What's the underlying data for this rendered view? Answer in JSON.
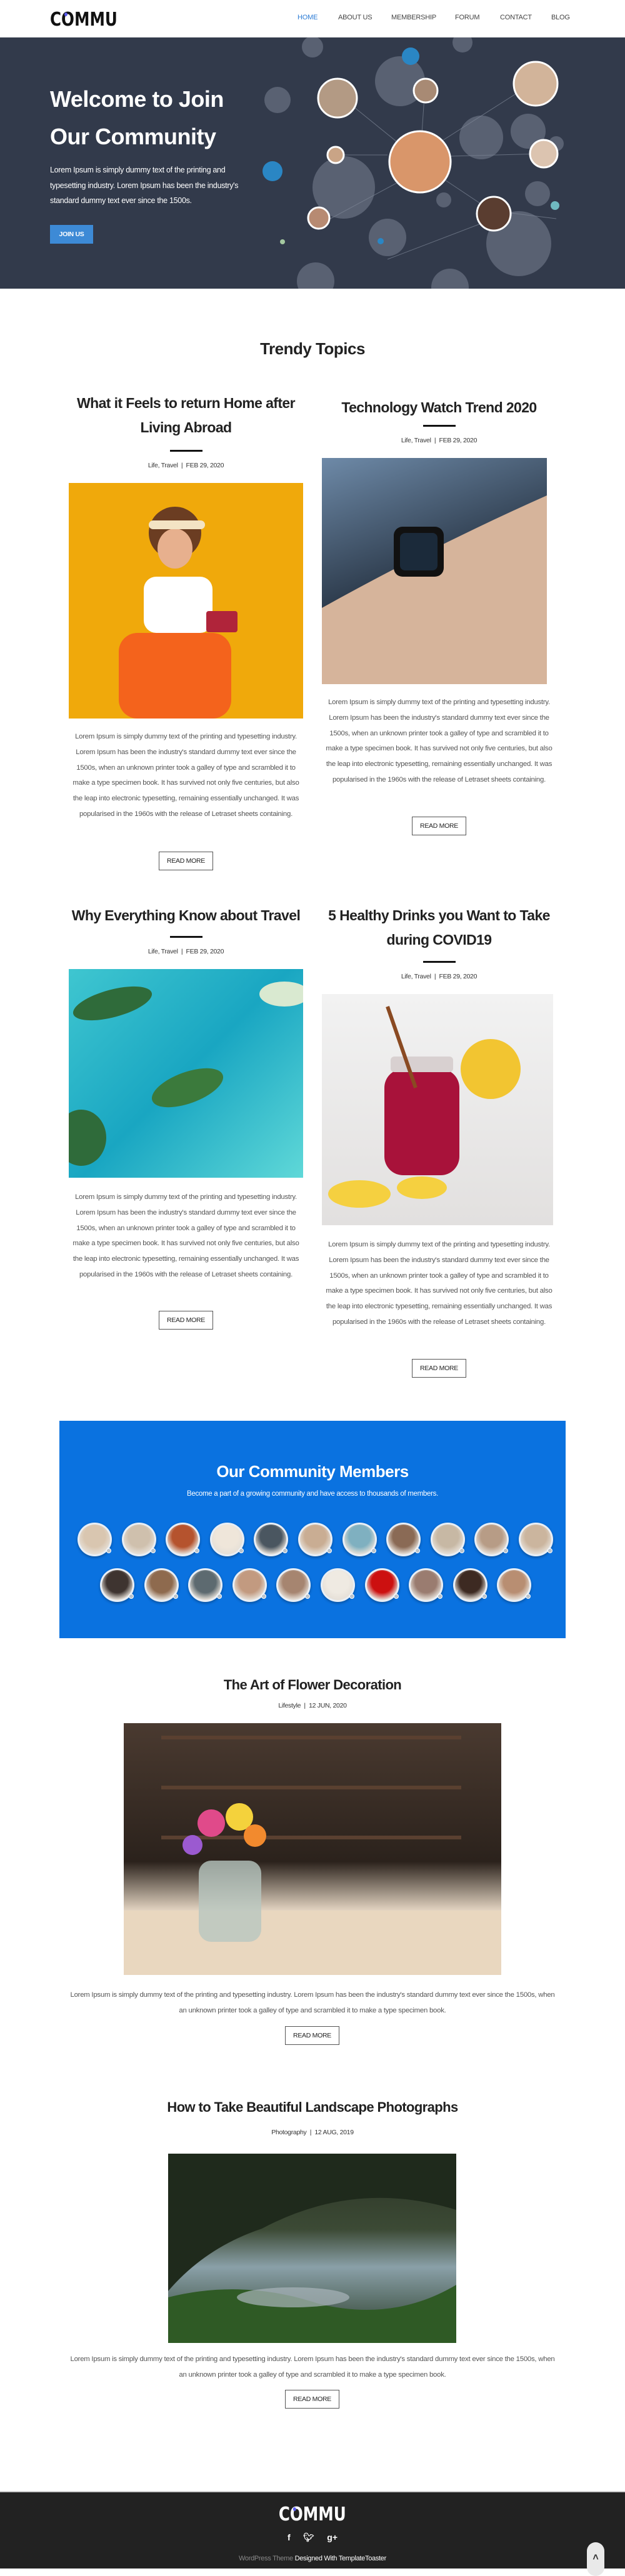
{
  "brand": {
    "logo": "COMMU",
    "accent": "#2e7dd6"
  },
  "nav": {
    "items": [
      {
        "label": "HOME",
        "active": true
      },
      {
        "label": "ABOUT US"
      },
      {
        "label": "MEMBERSHIP"
      },
      {
        "label": "FORUM"
      },
      {
        "label": "CONTACT"
      },
      {
        "label": "BLOG"
      }
    ]
  },
  "hero": {
    "title_line1": "Welcome to Join",
    "title_line2": "Our Community",
    "text": "Lorem Ipsum is simply dummy text of the printing and typesetting industry. Lorem Ipsum has been the industry's standard dummy text ever since the 1500s.",
    "button": "JOIN US"
  },
  "trendy": {
    "title": "Trendy Topics",
    "read_more": "READ MORE",
    "posts": [
      {
        "title": "What it Feels to return Home after Living Abroad",
        "categories": "Life, Travel",
        "date": "FEB 29, 2020",
        "image": "woman-with-orange-suitcase",
        "text": "Lorem Ipsum is simply dummy text of the printing and typesetting industry. Lorem Ipsum has been the industry's standard dummy text ever since the 1500s, when an unknown printer took a galley of type and scrambled it to make a type specimen book. It has survived not only five centuries, but also the leap into electronic typesetting, remaining essentially unchanged. It was popularised in the 1960s with the release of Letraset sheets containing."
      },
      {
        "title": "Technology Watch Trend 2020",
        "categories": "Life, Travel",
        "date": "FEB 29, 2020",
        "image": "smartwatch-on-steering-wheel",
        "text": "Lorem Ipsum is simply dummy text of the printing and typesetting industry. Lorem Ipsum has been the industry's standard dummy text ever since the 1500s, when an unknown printer took a galley of type and scrambled it to make a type specimen book. It has survived not only five centuries, but also the leap into electronic typesetting, remaining essentially unchanged. It was popularised in the 1960s with the release of Letraset sheets containing."
      },
      {
        "title": "Why Everything Know about Travel",
        "categories": "Life, Travel",
        "date": "FEB 29, 2020",
        "image": "aerial-island-sea",
        "text": "Lorem Ipsum is simply dummy text of the printing and typesetting industry. Lorem Ipsum has been the industry's standard dummy text ever since the 1500s, when an unknown printer took a galley of type and scrambled it to make a type specimen book. It has survived not only five centuries, but also the leap into electronic typesetting, remaining essentially unchanged. It was popularised in the 1960s with the release of Letraset sheets containing."
      },
      {
        "title": "5 Healthy Drinks you Want to Take during COVID19",
        "categories": "Life, Travel",
        "date": "FEB 29, 2020",
        "image": "berry-drink-jar-lemon",
        "text": "Lorem Ipsum is simply dummy text of the printing and typesetting industry. Lorem Ipsum has been the industry's standard dummy text ever since the 1500s, when an unknown printer took a galley of type and scrambled it to make a type specimen book. It has survived not only five centuries, but also the leap into electronic typesetting, remaining essentially unchanged. It was popularised in the 1960s with the release of Letraset sheets containing."
      }
    ]
  },
  "community": {
    "title": "Our Community Members",
    "subtitle": "Become a part of a growing community and have access to thousands of members.",
    "background": "#0a72e0",
    "member_colors": [
      "#d9c6b0",
      "#cfc0ad",
      "#b5532e",
      "#efe6da",
      "#4a5660",
      "#c9ad93",
      "#7fb0c0",
      "#8a6a55",
      "#c7b8a4",
      "#b79c86",
      "#cbb59e",
      "#3e3430",
      "#8e6a4e",
      "#5d6a70",
      "#c29a80",
      "#a68570",
      "#efeae2",
      "#cc1010",
      "#9a7c70",
      "#3d2a22",
      "#b88e72"
    ]
  },
  "articles": [
    {
      "title": "The Art of Flower Decoration",
      "category": "Lifestyle",
      "date": "12 JUN, 2020",
      "image": "flowers-in-glass-jar",
      "text": "Lorem Ipsum is simply dummy text of the printing and typesetting industry. Lorem Ipsum has been the industry's standard dummy text ever since the 1500s, when an unknown printer took a galley of type and scrambled it to make a type specimen book.",
      "button": "READ MORE"
    },
    {
      "title": "How to Take Beautiful Landscape Photographs",
      "category": "Photography",
      "date": "12 AUG, 2019",
      "image": "cave-landscape-water",
      "text": "Lorem Ipsum is simply dummy text of the printing and typesetting industry. Lorem Ipsum has been the industry's standard dummy text ever since the 1500s, when an unknown printer took a galley of type and scrambled it to make a type specimen book.",
      "button": "READ MORE"
    }
  ],
  "footer": {
    "logo": "COMMU",
    "social": [
      "facebook-icon",
      "twitter-icon",
      "google-plus-icon"
    ],
    "credit_prefix": "WordPress Theme",
    "credit_suffix": "Designed With TemplateToaster"
  }
}
